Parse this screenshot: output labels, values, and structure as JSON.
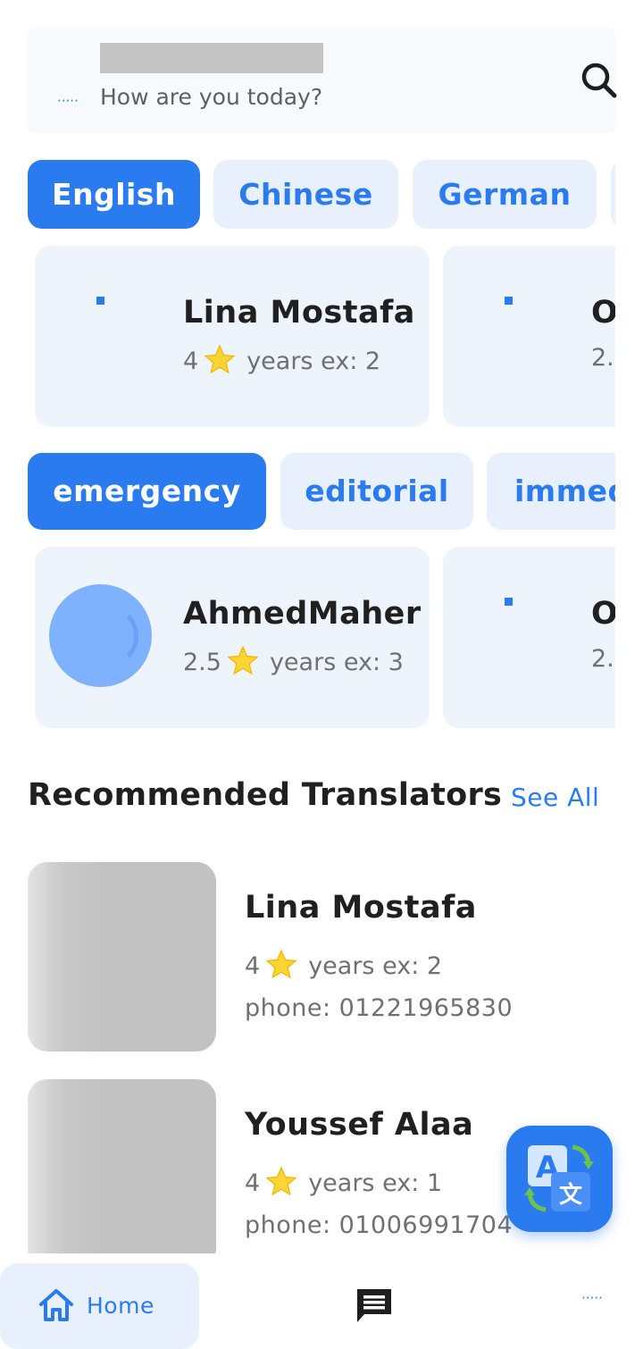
{
  "header": {
    "greeting": "How are you today?",
    "menu_icon": "dots-icon",
    "search_icon": "search-icon"
  },
  "languages": [
    {
      "label": "English",
      "active": true
    },
    {
      "label": "Chinese",
      "active": false
    },
    {
      "label": "German",
      "active": false
    }
  ],
  "language_cards": [
    {
      "name": "Lina Mostafa",
      "rating": "4",
      "years": "years ex: 2"
    },
    {
      "name": "O",
      "rating": "2."
    }
  ],
  "categories": [
    {
      "label": "emergency",
      "active": true
    },
    {
      "label": "editorial",
      "active": false
    },
    {
      "label": "immed",
      "active": false
    }
  ],
  "category_cards": [
    {
      "name": "AhmedMaher",
      "rating": "2.5",
      "years": "years ex: 3"
    },
    {
      "name": "O",
      "rating": "2."
    }
  ],
  "recommended": {
    "title": "Recommended Translators",
    "see_all": "See All",
    "items": [
      {
        "name": "Lina Mostafa",
        "rating": "4",
        "years": "years ex: 2",
        "phone": "phone: 01221965830"
      },
      {
        "name": "Youssef Alaa",
        "rating": "4",
        "years": "years ex: 1",
        "phone": "phone: 01006991704"
      }
    ]
  },
  "fab": {
    "icon": "translate-icon"
  },
  "nav": {
    "home_label": "Home",
    "home_icon": "home-icon",
    "chat_icon": "chat-icon",
    "more_icon": "dots-icon"
  },
  "colors": {
    "accent": "#2b7bf0",
    "chip_bg": "#e8f0fd",
    "card_bg": "#eef4fc"
  }
}
